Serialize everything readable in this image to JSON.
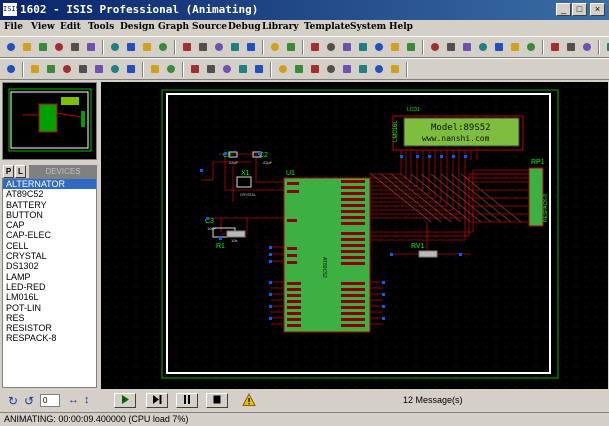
{
  "window": {
    "title": "1602 - ISIS Professional (Animating)",
    "app_icon_text": "ISIS"
  },
  "menu": [
    "File",
    "View",
    "Edit",
    "Tools",
    "Design",
    "Graph",
    "Source",
    "Debug",
    "Library",
    "Template",
    "System",
    "Help"
  ],
  "toolbar_icons": {
    "row1": [
      "new-file-icon",
      "open-file-icon",
      "save-icon",
      "import-icon",
      "export-icon",
      "print-icon",
      "area-icon",
      "redraw-icon",
      "grid-icon",
      "origin-icon",
      "pan-icon",
      "zoom-in-icon",
      "zoom-out-icon",
      "zoom-all-icon",
      "zoom-area-icon",
      "undo-icon",
      "redo-icon",
      "cut-icon",
      "copy-icon",
      "paste-icon",
      "block-copy-icon",
      "block-move-icon",
      "block-rotate-icon",
      "block-delete-icon",
      "pick-device-icon",
      "make-device-icon",
      "packaging-icon",
      "decompose-icon",
      "wire-autorouter-icon",
      "search-icon",
      "property-assign-icon",
      "new-sheet-icon",
      "remove-sheet-icon",
      "goto-sheet-icon",
      "bill-of-materials-icon",
      "electrical-rules-icon",
      "netlist-icon"
    ],
    "row2": [
      "selection-icon",
      "component-icon",
      "junction-icon",
      "wire-label-icon",
      "text-script-icon",
      "buses-icon",
      "subcircuit-icon",
      "terminal-icon",
      "device-pin-icon",
      "graph-icon",
      "tape-icon",
      "generator-icon",
      "voltage-probe-icon",
      "current-probe-icon",
      "virtual-instrument-icon",
      "line-icon",
      "box-icon",
      "circle-icon",
      "arc-icon",
      "path-icon",
      "text-icon",
      "symbol-icon",
      "marker-icon"
    ]
  },
  "panel": {
    "tab_p": "P",
    "tab_l": "L",
    "header": "DEVICES",
    "devices": [
      "ALTERNATOR",
      "AT89C52",
      "BATTERY",
      "BUTTON",
      "CAP",
      "CAP-ELEC",
      "CELL",
      "CRYSTAL",
      "DS1302",
      "LAMP",
      "LED-RED",
      "LM016L",
      "POT-LIN",
      "RES",
      "RESISTOR",
      "RESPACK-8"
    ],
    "selected_device": "ALTERNATOR"
  },
  "rotation": {
    "angle": "0"
  },
  "schematic": {
    "lcd_ref": "LCD1",
    "lcd_part": "LM016L",
    "lcd_line1": "Model:89S52",
    "lcd_line2": "www.nanshi.com",
    "u1_ref": "U1",
    "u1_part": "AT89C52",
    "c1_ref": "C1",
    "c1_value": "22pF",
    "c2_ref": "C2",
    "c2_value": "22pF",
    "x1_ref": "X1",
    "x1_value": "CRYSTAL",
    "c3_ref": "C3",
    "c3_value": "10uF",
    "r1_ref": "R1",
    "r1_value": "10k",
    "rv1_ref": "RV1",
    "rp1_ref": "RP1",
    "rp1_part": "RESPACK-8"
  },
  "simulation": {
    "messages": "12 Message(s)",
    "warning_icon": "warning-icon"
  },
  "status": {
    "text": "ANIMATING: 00:00:09.400000 (CPU load 7%)"
  }
}
